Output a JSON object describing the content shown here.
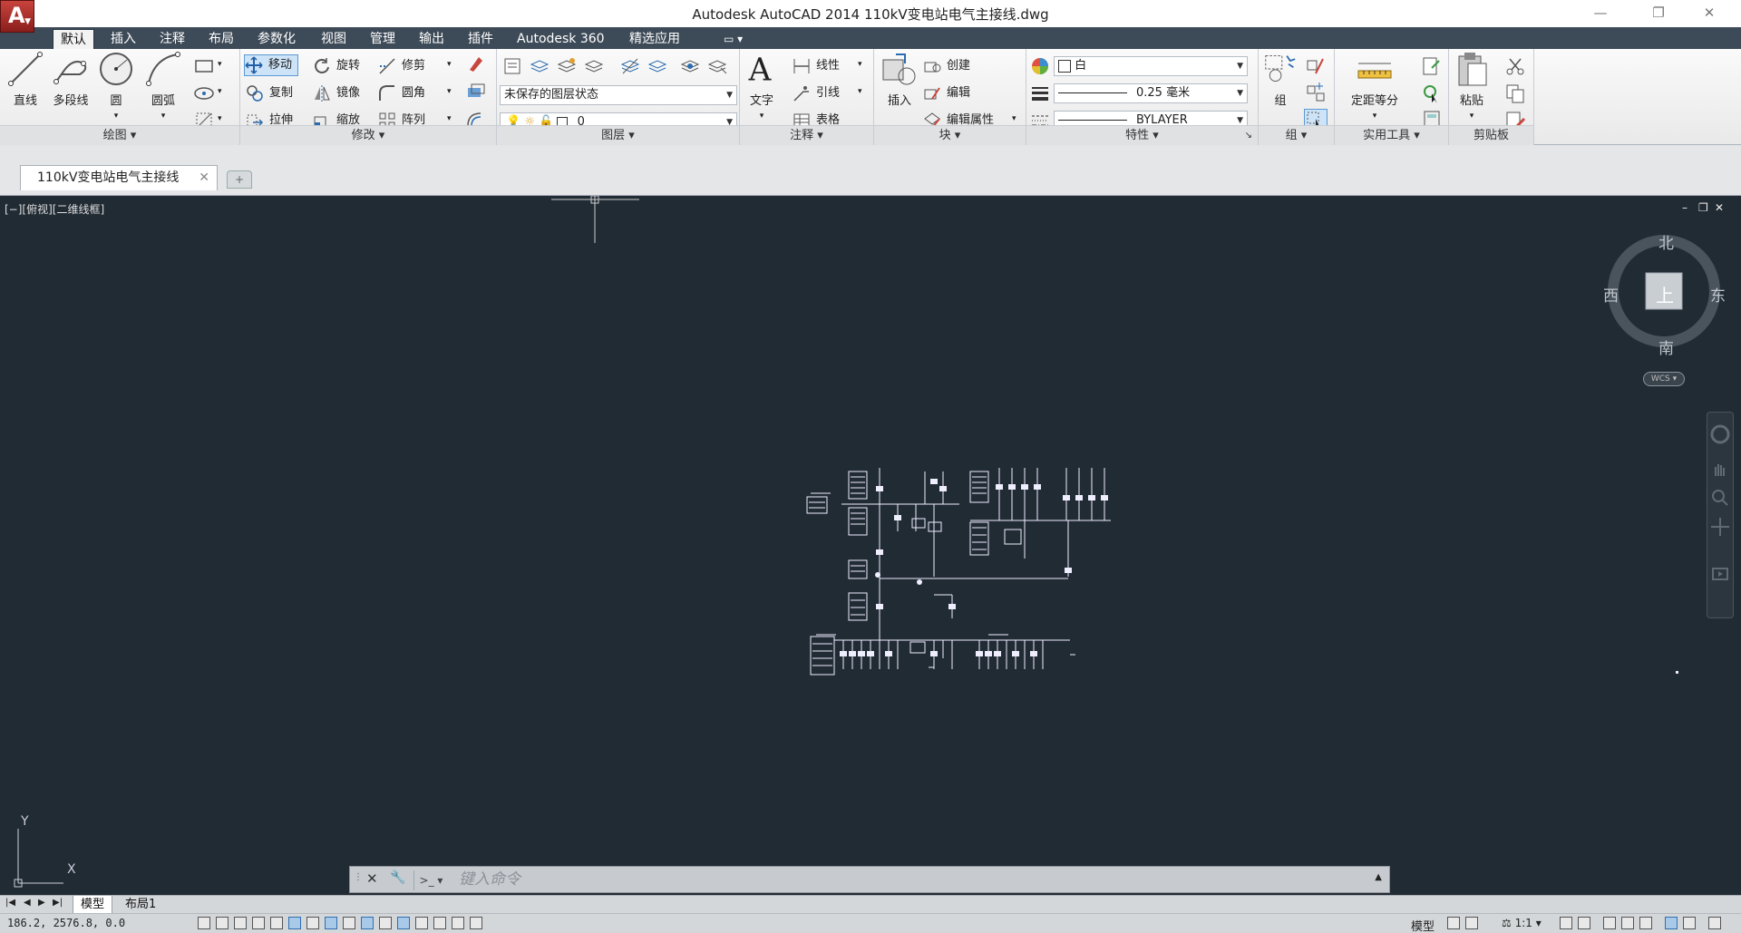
{
  "app": {
    "title": "Autodesk AutoCAD 2014    110kV变电站电气主接线.dwg",
    "menu_letter": "A"
  },
  "window_controls": {
    "minimize": "—",
    "restore": "❐",
    "close": "✕"
  },
  "ribbon_tabs": [
    "默认",
    "插入",
    "注释",
    "布局",
    "参数化",
    "视图",
    "管理",
    "输出",
    "插件",
    "Autodesk 360",
    "精选应用"
  ],
  "ribbon_tabs_extra": "▭ ▾",
  "draw": {
    "line": "直线",
    "polyline": "多段线",
    "circle": "圆",
    "arc": "圆弧",
    "title": "绘图 ▾"
  },
  "modify": {
    "move": "移动",
    "rotate": "旋转",
    "trim": "修剪",
    "copy": "复制",
    "mirror": "镜像",
    "fillet": "圆角",
    "stretch": "拉伸",
    "scale": "缩放",
    "array": "阵列",
    "title": "修改 ▾"
  },
  "layers": {
    "state": "未保存的图层状态",
    "current": "0",
    "title": "图层 ▾"
  },
  "annotation": {
    "text": "文字",
    "dimension": "线性",
    "leader": "引线",
    "table": "表格",
    "title": "注释 ▾"
  },
  "block": {
    "insert": "插入",
    "create": "创建",
    "edit": "编辑",
    "edit_attr": "编辑属性",
    "title": "块 ▾"
  },
  "properties": {
    "color": "白",
    "lineweight": "0.25 毫米",
    "linetype": "BYLAYER",
    "title": "特性 ▾",
    "launcher": "↘"
  },
  "groups": {
    "group": "组",
    "title": "组 ▾"
  },
  "utilities": {
    "measure": "定距等分",
    "title": "实用工具 ▾"
  },
  "clipboard": {
    "paste": "粘贴",
    "title": "剪贴板"
  },
  "document": {
    "tab": "110kV变电站电气主接线",
    "close": "✕",
    "new_tab": "+"
  },
  "viewport": {
    "label": "[−][俯视][二维线框]",
    "minimize": "–",
    "restore": "❐",
    "close": "✕"
  },
  "viewcube": {
    "north": "北",
    "south": "南",
    "east": "东",
    "west": "西",
    "top": "上",
    "wcs": "WCS ▾"
  },
  "ucs": {
    "x": "X",
    "y": "Y"
  },
  "command": {
    "placeholder": "键入命令",
    "close": "✕",
    "settings": "🔧",
    "expand": "▲"
  },
  "layout_tabs": {
    "model": "模型",
    "layout1": "布局1"
  },
  "status": {
    "coords": "186.2,  2576.8, 0.0",
    "model": "模型",
    "scale": "1:1 ▾"
  }
}
